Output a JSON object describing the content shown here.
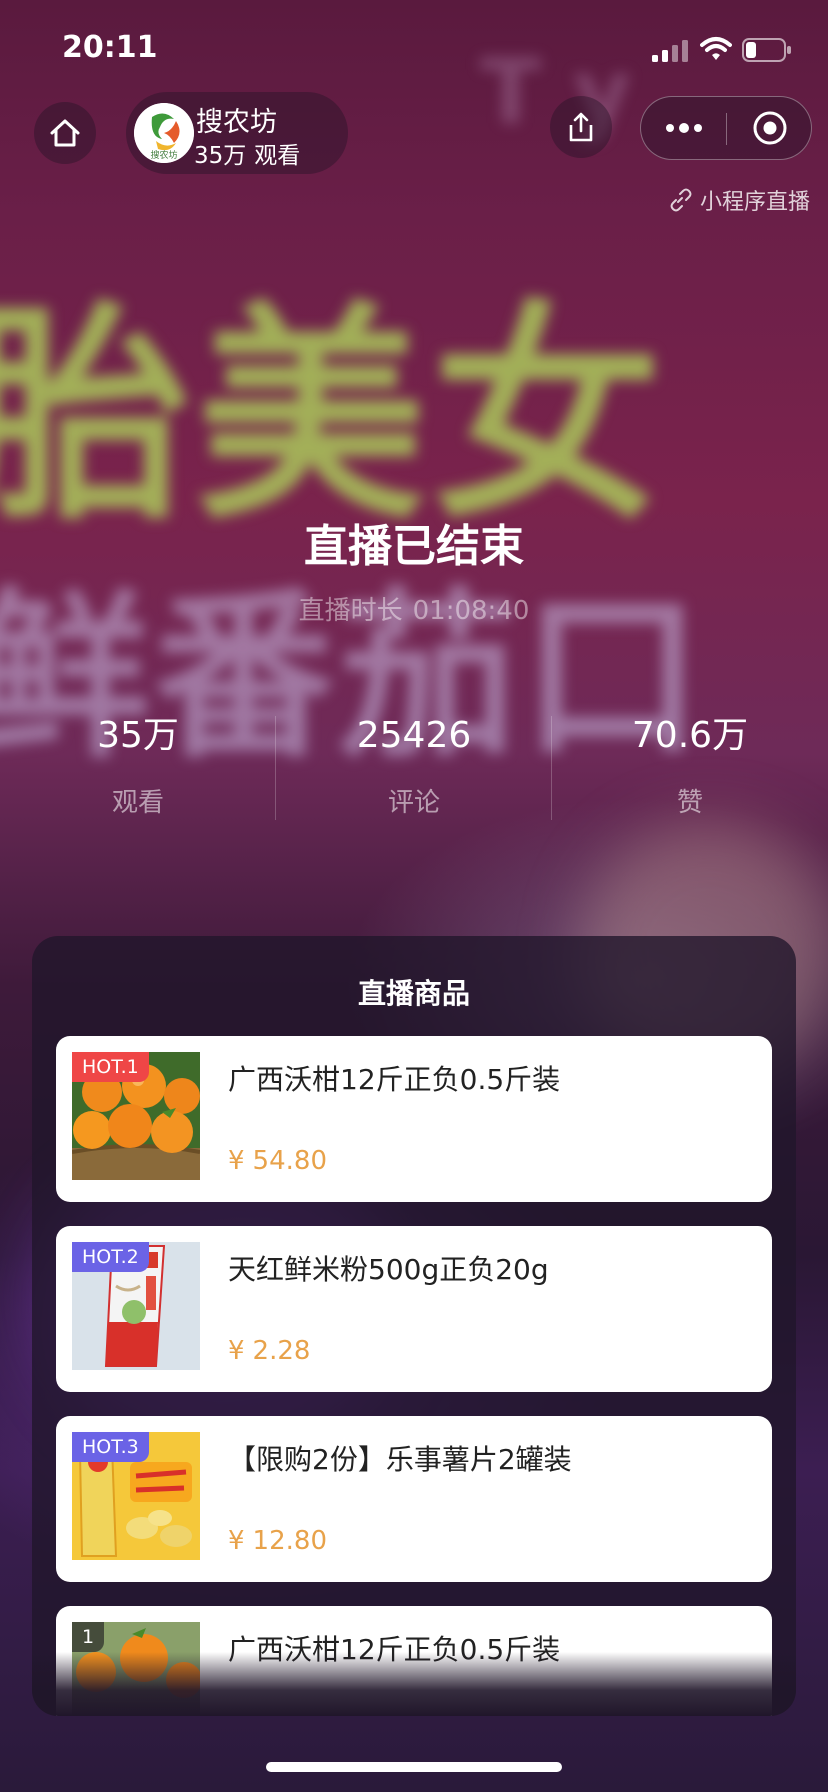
{
  "status_bar": {
    "time": "20:11"
  },
  "header": {
    "anchor_name": "搜农坊",
    "avatar_text": "搜农坊",
    "view_count": "35万",
    "view_label": "观看",
    "mini_program_live_label": "小程序直播",
    "icons": {
      "home": "home-icon",
      "share": "share-icon",
      "more": "more-dots-icon",
      "close": "close-target-icon",
      "link": "link-icon"
    }
  },
  "live_status": {
    "title": "直播已结束",
    "duration_label": "直播时长",
    "duration_value": "01:08:40"
  },
  "stats": [
    {
      "value": "35万",
      "label": "观看"
    },
    {
      "value": "25426",
      "label": "评论"
    },
    {
      "value": "70.6万",
      "label": "赞"
    }
  ],
  "products": {
    "title": "直播商品",
    "items": [
      {
        "badge": "HOT.1",
        "title": "广西沃柑12斤正负0.5斤装",
        "currency": "¥",
        "price": "54.80",
        "image": "oranges"
      },
      {
        "badge": "HOT.2",
        "title": "天红鲜米粉500g正负20g",
        "currency": "¥",
        "price": "2.28",
        "image": "rice-noodle-pack"
      },
      {
        "badge": "HOT.3",
        "title": "【限购2份】乐事薯片2罐装",
        "currency": "¥",
        "price": "12.80",
        "image": "potato-chips"
      },
      {
        "badge": "1",
        "title": "广西沃柑12斤正负0.5斤装",
        "currency": "¥",
        "price": "",
        "image": "oranges"
      }
    ]
  },
  "colors": {
    "price": "#e8a24a",
    "hot_badge_red": "#ef4646",
    "hot_badge_purple": "#6b63e6",
    "panel_background": "#20162a"
  }
}
